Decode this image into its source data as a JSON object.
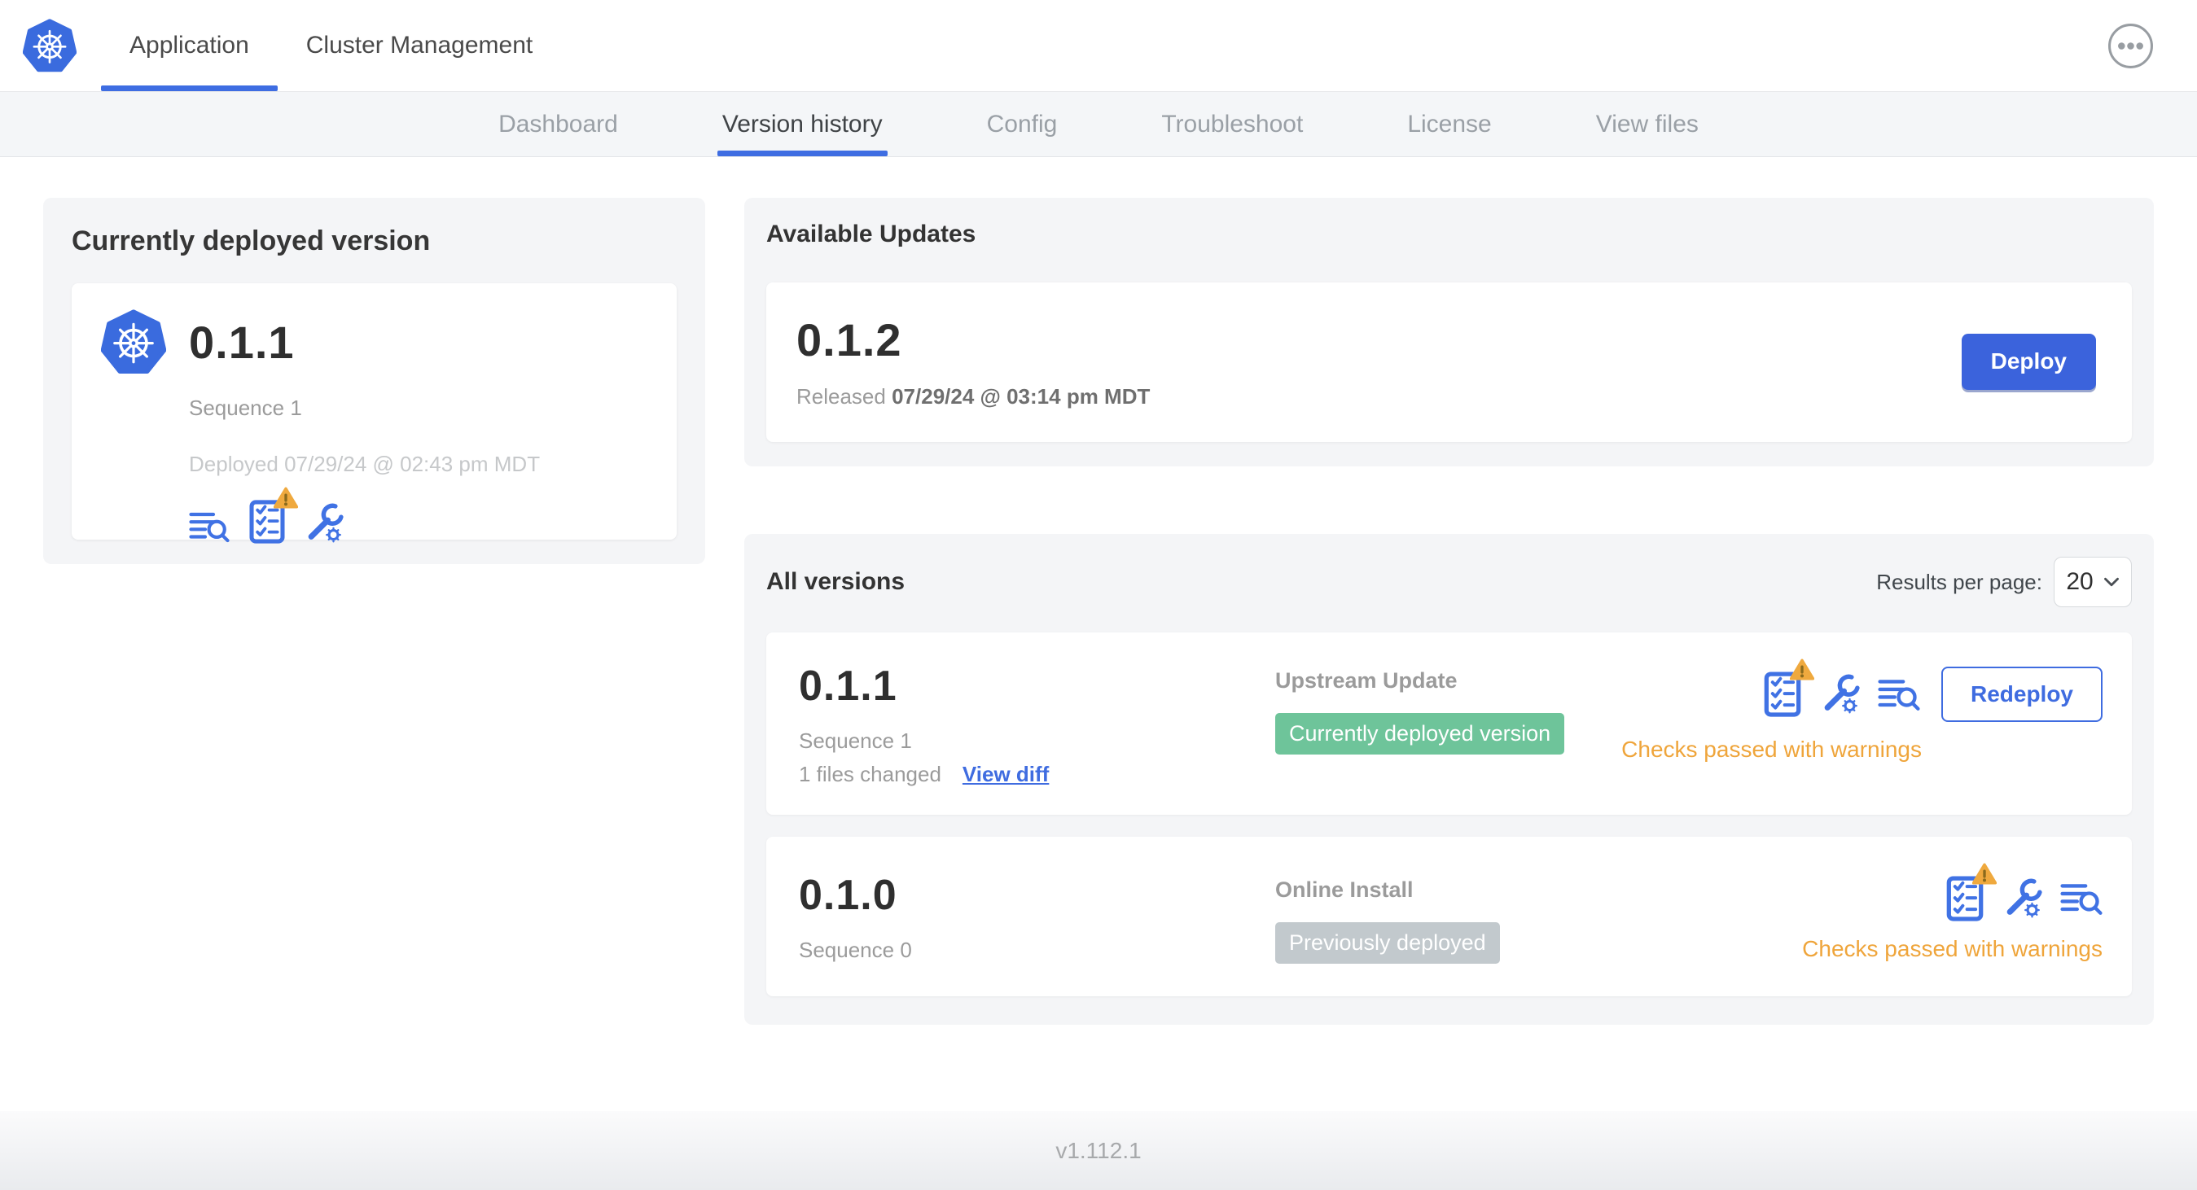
{
  "header": {
    "tabs": [
      {
        "label": "Application",
        "active": true
      },
      {
        "label": "Cluster Management",
        "active": false
      }
    ]
  },
  "subnav": {
    "tabs": [
      {
        "label": "Dashboard",
        "active": false
      },
      {
        "label": "Version history",
        "active": true
      },
      {
        "label": "Config",
        "active": false
      },
      {
        "label": "Troubleshoot",
        "active": false
      },
      {
        "label": "License",
        "active": false
      },
      {
        "label": "View files",
        "active": false
      }
    ]
  },
  "deployed": {
    "title": "Currently deployed version",
    "version": "0.1.1",
    "sequence": "Sequence 1",
    "deployed_at": "Deployed 07/29/24 @ 02:43 pm MDT"
  },
  "available_updates": {
    "title": "Available Updates",
    "version": "0.1.2",
    "released_prefix": "Released",
    "released_at": "07/29/24 @ 03:14 pm MDT",
    "deploy_label": "Deploy"
  },
  "all_versions": {
    "title": "All versions",
    "results_per_page_label": "Results per page:",
    "results_per_page_value": "20",
    "rows": [
      {
        "version": "0.1.1",
        "sequence": "Sequence 1",
        "files_changed": "1 files changed",
        "view_diff_label": "View diff",
        "source": "Upstream Update",
        "badge": "Currently deployed version",
        "badge_color": "#6EC49A",
        "status": "Checks passed with warnings",
        "action_label": "Redeploy"
      },
      {
        "version": "0.1.0",
        "sequence": "Sequence 0",
        "source": "Online Install",
        "badge": "Previously deployed",
        "badge_color": "#C2C9CD",
        "status": "Checks passed with warnings"
      }
    ]
  },
  "footer": {
    "app_version": "v1.112.1"
  },
  "icons": {
    "kubernetes-logo": "blue heptagon with white helm wheel",
    "more-options-icon": "ellipsis in circle",
    "view-logs-icon": "text lines with magnifying glass",
    "preflight-checks-icon": "checklist clipboard",
    "warning-triangle-icon": "amber triangle with exclamation",
    "config-wrench-icon": "wrench with gear",
    "chevron-down-icon": "dropdown caret"
  },
  "colors": {
    "accent_blue": "#3E6CE0",
    "logo_blue": "#3A6BDE",
    "green_badge": "#6EC49A",
    "gray_badge": "#C2C9CD",
    "warning_text": "#EFA53B",
    "warning_triangle": "#EFA93E",
    "card_background": "#F4F5F7"
  }
}
